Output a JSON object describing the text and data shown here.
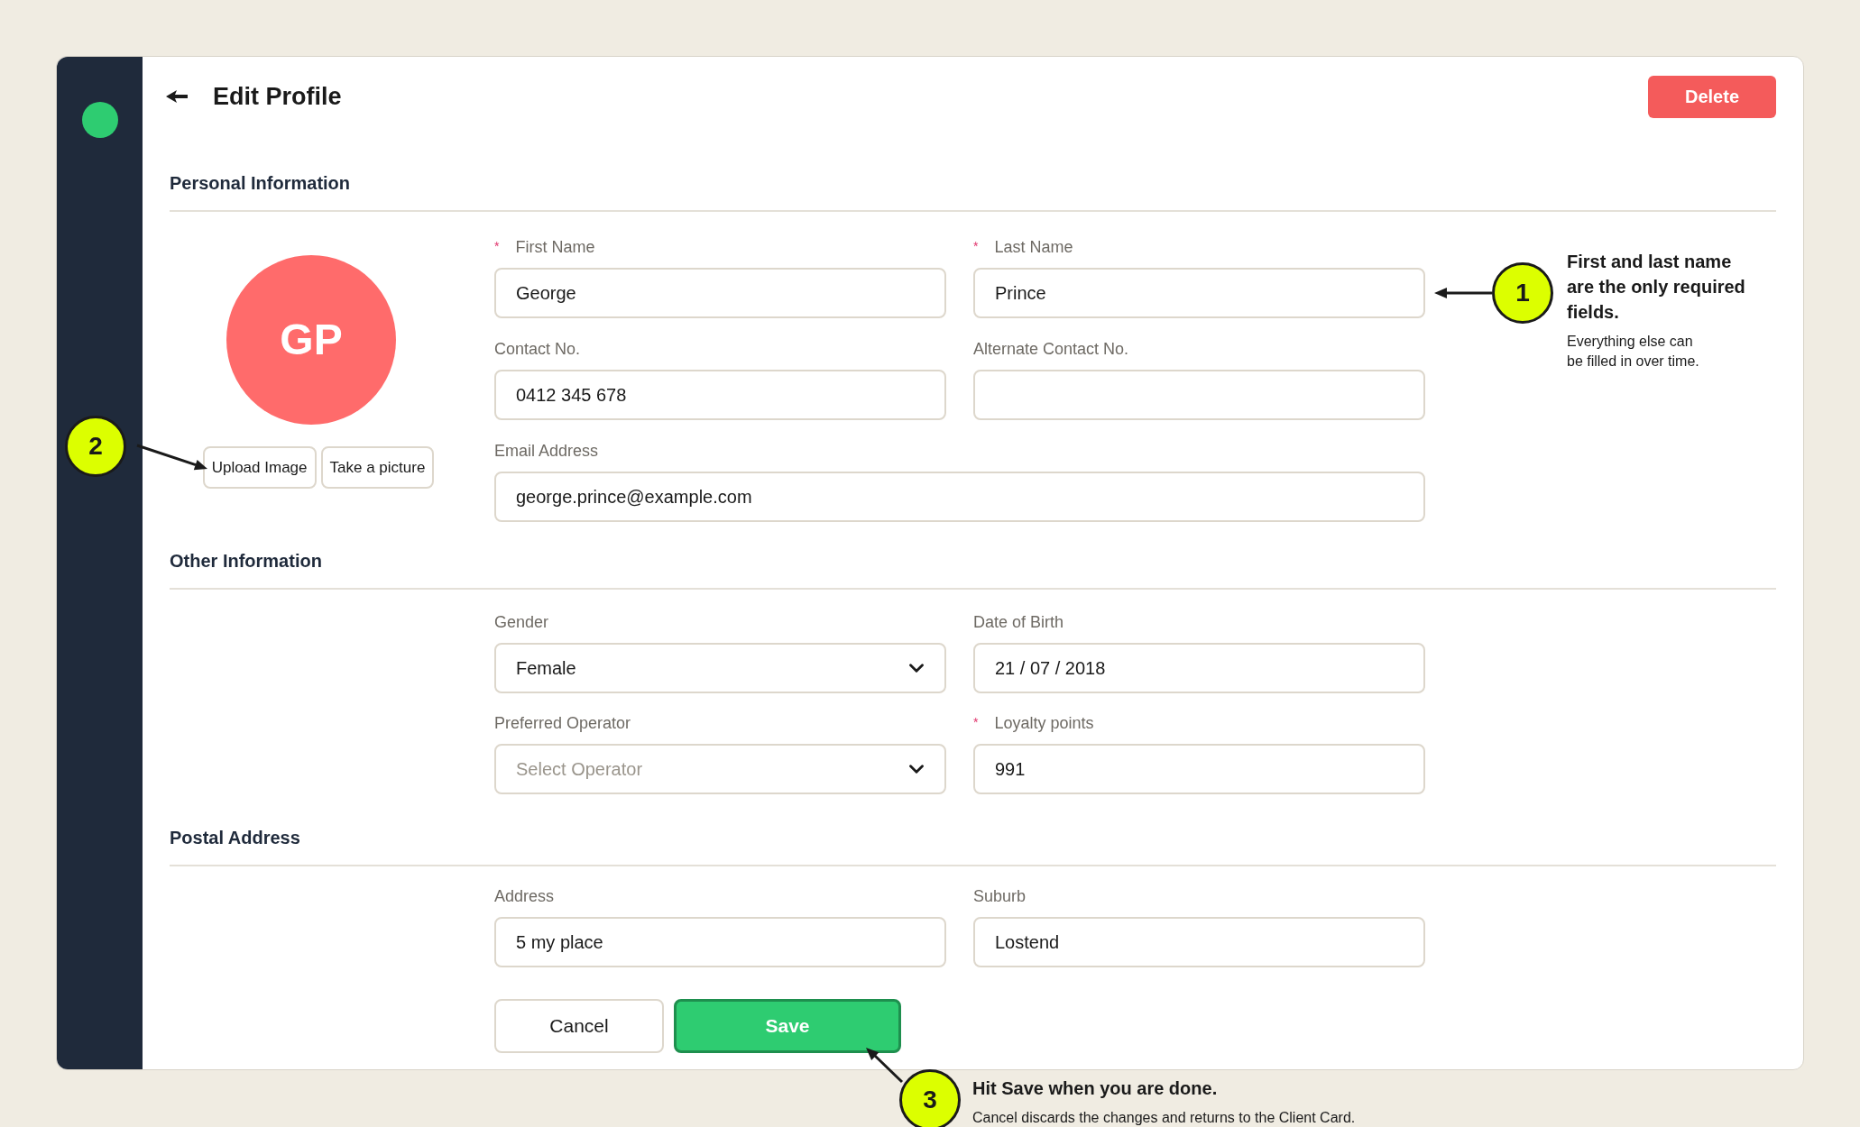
{
  "header": {
    "title": "Edit Profile",
    "delete_button": "Delete"
  },
  "sections": [
    {
      "title": "Personal Information",
      "avatar": {
        "initials": "GP",
        "buttons": [
          "Upload Image",
          "Take a picture"
        ]
      },
      "rows": [
        [
          {
            "label": "First Name",
            "required_mark": "*",
            "kind": "text",
            "value": "George"
          },
          {
            "label": "Last Name",
            "required_mark": "*",
            "kind": "text",
            "value": "Prince"
          }
        ],
        [
          {
            "label": "Contact No.",
            "kind": "text",
            "value": "0412 345 678"
          },
          {
            "label": "Alternate Contact No.",
            "kind": "text"
          }
        ],
        [
          {
            "label": "Email Address",
            "kind": "text",
            "value": "george.prince@example.com"
          }
        ]
      ]
    },
    {
      "title": "Other Information",
      "rows": [
        [
          {
            "label": "Gender",
            "kind": "select",
            "value": "Female"
          },
          {
            "label": "Date of Birth",
            "kind": "text",
            "value": "21 / 07 / 2018"
          }
        ],
        [
          {
            "label": "Preferred Operator",
            "kind": "select",
            "placeholder": "Select Operator"
          },
          {
            "label": "Loyalty points",
            "required_mark": "*",
            "kind": "text",
            "value": "991"
          }
        ]
      ]
    },
    {
      "title": "Postal Address",
      "rows": [
        [
          {
            "label": "Address",
            "kind": "text",
            "value": "5 my place"
          },
          {
            "label": "Suburb",
            "kind": "text",
            "value": "Lostend"
          }
        ]
      ]
    }
  ],
  "actions": {
    "cancel": "Cancel",
    "save": "Save"
  },
  "annotations": [
    {
      "number": "1",
      "title": "First and last name are the only required fields.",
      "note": "Everything else can be filled in over time."
    },
    {
      "number": "2"
    },
    {
      "number": "3",
      "title": "Hit Save when you are done.",
      "note": "Cancel discards the changes and returns to the Client Card."
    }
  ]
}
